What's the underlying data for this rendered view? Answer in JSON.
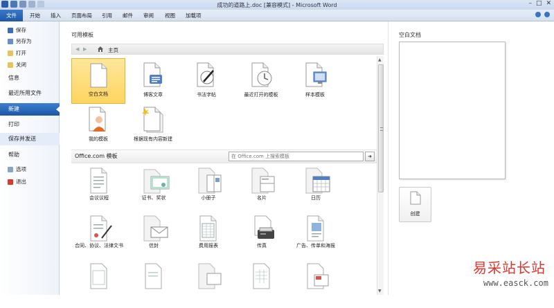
{
  "window": {
    "title": "成功的道路上.doc [兼容模式] - Microsoft Word",
    "controls": [
      "–",
      "□",
      "✕"
    ]
  },
  "ribbon": {
    "file_tab": "文件",
    "tabs": [
      "开始",
      "插入",
      "页面布局",
      "引用",
      "邮件",
      "审阅",
      "视图",
      "加载项"
    ]
  },
  "leftnav": {
    "save": "保存",
    "save_as": "另存为",
    "open": "打开",
    "close": "关闭",
    "info": "信息",
    "recent": "最近所用文件",
    "new": "新建",
    "print": "打印",
    "save_send": "保存并发送",
    "help": "帮助",
    "options": "选项",
    "exit": "退出"
  },
  "available": {
    "heading": "可用模板",
    "home": "主页",
    "tiles": [
      {
        "label": "空白文档",
        "icon": "blank-doc-icon"
      },
      {
        "label": "博客文章",
        "icon": "blog-post-icon"
      },
      {
        "label": "书法字帖",
        "icon": "calligraphy-icon"
      },
      {
        "label": "最近打开的模板",
        "icon": "recent-templates-icon"
      },
      {
        "label": "样本模板",
        "icon": "sample-templates-icon"
      },
      {
        "label": "我的模板",
        "icon": "my-templates-icon"
      },
      {
        "label": "根据现有内容新建",
        "icon": "new-from-existing-icon"
      }
    ]
  },
  "office": {
    "heading": "Office.com 模板",
    "search_placeholder": "在 Office.com 上搜索模板",
    "search_button": "➜",
    "tiles": [
      {
        "label": "会议议程",
        "icon": "agenda-icon"
      },
      {
        "label": "证书、奖状",
        "icon": "certificate-icon"
      },
      {
        "label": "小册子",
        "icon": "brochure-icon"
      },
      {
        "label": "名片",
        "icon": "business-card-icon"
      },
      {
        "label": "日历",
        "icon": "calendar-icon"
      },
      {
        "label": "合同、协议、法律文书",
        "icon": "contract-icon"
      },
      {
        "label": "信封",
        "icon": "envelope-icon"
      },
      {
        "label": "费用报表",
        "icon": "expense-report-icon"
      },
      {
        "label": "传真",
        "icon": "fax-icon"
      },
      {
        "label": "广告、传单和海报",
        "icon": "flyer-icon"
      }
    ]
  },
  "preview": {
    "title": "空白文档",
    "create": "创建"
  },
  "watermark": {
    "text": "易采站长站",
    "url": "www.easck.com"
  },
  "colors": {
    "accent": "#1f5aa8",
    "selected_tile": "#ffd460",
    "watermark": "#e2342b"
  }
}
